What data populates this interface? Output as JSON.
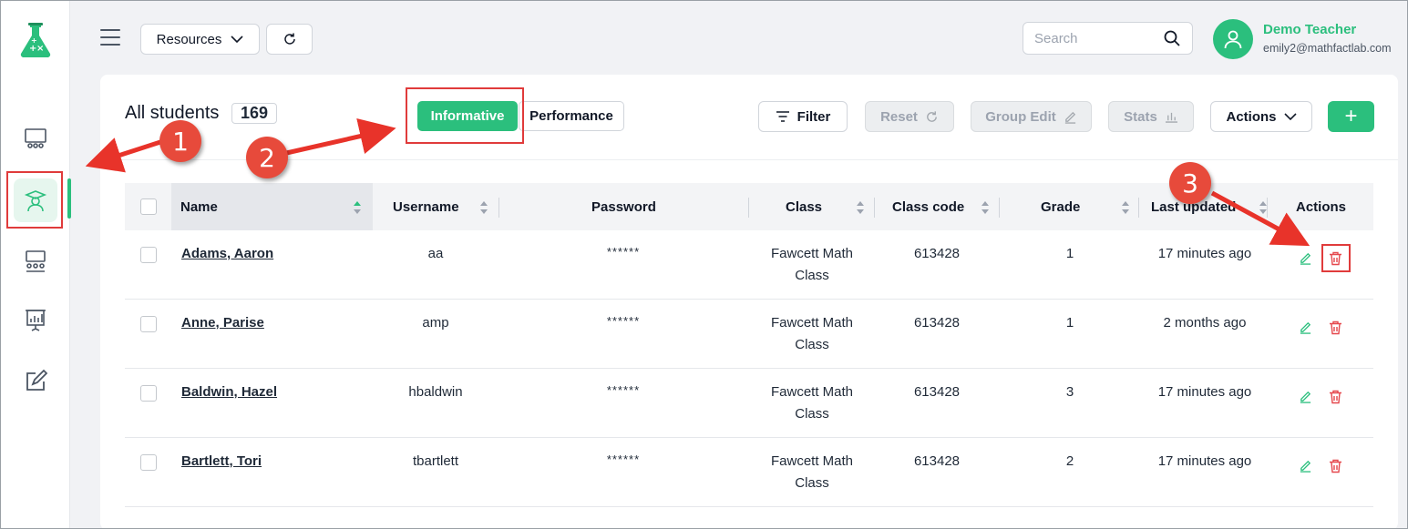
{
  "header": {
    "resources_label": "Resources",
    "search_placeholder": "Search",
    "user_name": "Demo Teacher",
    "user_email": "emily2@mathfactlab.com"
  },
  "sidebar": {
    "items": [
      {
        "name": "classroom-icon"
      },
      {
        "name": "student-icon",
        "active": true
      },
      {
        "name": "groups-icon"
      },
      {
        "name": "presentation-chart-icon"
      },
      {
        "name": "edit-icon"
      }
    ]
  },
  "page": {
    "title": "All students",
    "count": "169",
    "view_toggle": {
      "active": "Informative",
      "inactive": "Performance"
    },
    "toolbar": {
      "filter": "Filter",
      "reset": "Reset",
      "group_edit": "Group Edit",
      "stats": "Stats",
      "actions": "Actions",
      "add": "+"
    }
  },
  "table": {
    "columns": [
      "Name",
      "Username",
      "Password",
      "Class",
      "Class code",
      "Grade",
      "Last updated",
      "Actions"
    ],
    "rows": [
      {
        "name": "Adams, Aaron",
        "username": "aa",
        "password": "******",
        "class_l1": "Fawcett Math",
        "class_l2": "Class",
        "code": "613428",
        "grade": "1",
        "updated": "17 minutes ago"
      },
      {
        "name": "Anne, Parise",
        "username": "amp",
        "password": "******",
        "class_l1": "Fawcett Math",
        "class_l2": "Class",
        "code": "613428",
        "grade": "1",
        "updated": "2 months ago"
      },
      {
        "name": "Baldwin, Hazel",
        "username": "hbaldwin",
        "password": "******",
        "class_l1": "Fawcett Math",
        "class_l2": "Class",
        "code": "613428",
        "grade": "3",
        "updated": "17 minutes ago"
      },
      {
        "name": "Bartlett, Tori",
        "username": "tbartlett",
        "password": "******",
        "class_l1": "Fawcett Math",
        "class_l2": "Class",
        "code": "613428",
        "grade": "2",
        "updated": "17 minutes ago"
      }
    ]
  },
  "annotations": {
    "step1": "1",
    "step2": "2",
    "step3": "3",
    "color": "#e74a3b"
  },
  "colors": {
    "accent": "#2bbf7d",
    "danger": "#e5484d"
  }
}
